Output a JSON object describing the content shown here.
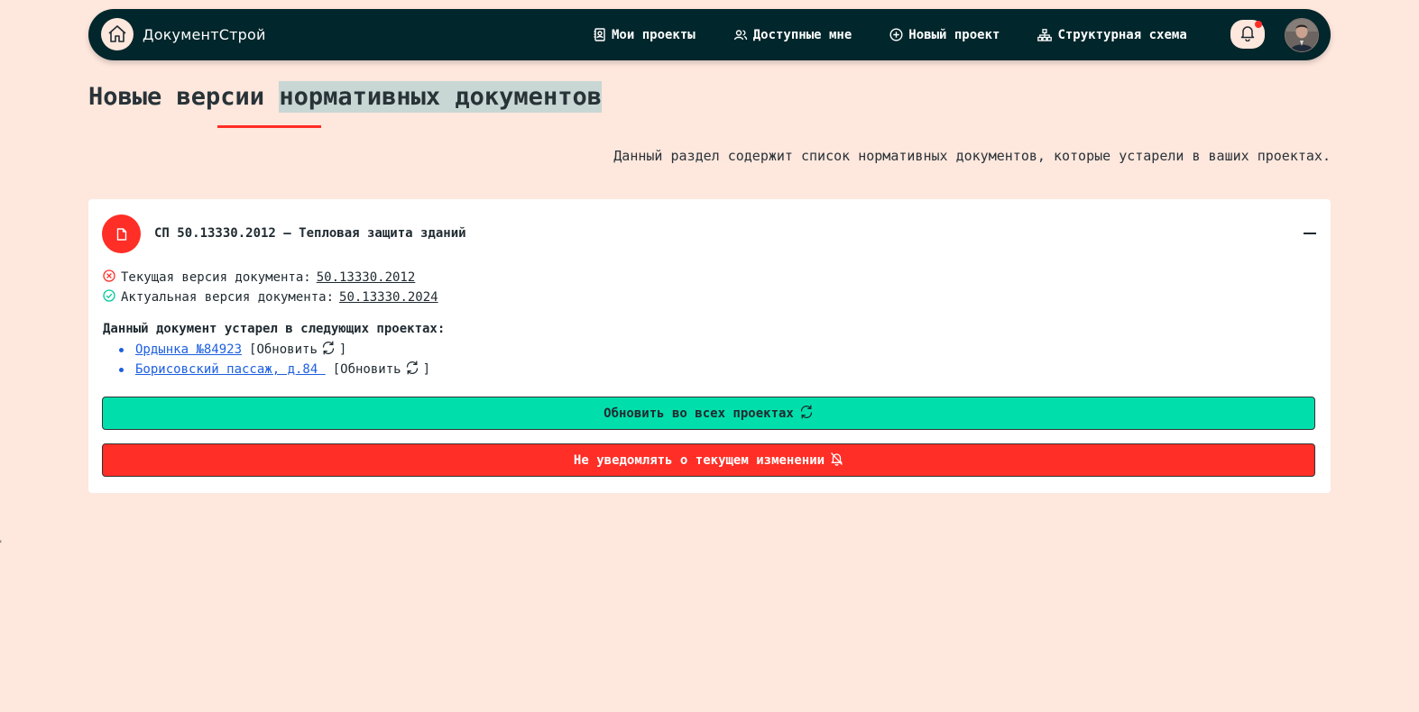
{
  "app": {
    "brand": "ДокументСтрой"
  },
  "nav": {
    "items": [
      {
        "label": "Мои проекты",
        "icon": "contact-book-icon"
      },
      {
        "label": "Доступные мне",
        "icon": "users-icon"
      },
      {
        "label": "Новый проект",
        "icon": "plus-circle-icon"
      },
      {
        "label": "Структурная схема",
        "icon": "hierarchy-icon"
      }
    ],
    "notifications_icon": "bell-icon",
    "has_unread": true
  },
  "page": {
    "title_part1": "Новые версии",
    "title_part2": "нормативных документов",
    "description": "Данный раздел содержит список нормативных документов, которые устарели в ваших проектах."
  },
  "document": {
    "title": "СП 50.13330.2012 — Тепловая защита зданий",
    "current_label": "Текущая версия документа:",
    "current_version": "50.13330.2012",
    "actual_label": "Актуальная версия документа:",
    "actual_version": "50.13330.2024",
    "outdated_heading": "Данный документ устарел в следующих проектах:",
    "projects": [
      {
        "name": "Ордынка №84923",
        "update_label": "[Обновить",
        "close_bracket": "]"
      },
      {
        "name": "Борисовский пассаж, д.84 ",
        "update_label": "[Обновить",
        "close_bracket": "]"
      }
    ],
    "update_all_label": "Обновить во всех проектах",
    "mute_label": "Не уведомлять о текущем изменении"
  },
  "colors": {
    "background": "#fee7dd",
    "navbar": "#01262b",
    "accent_red": "#ff2e26",
    "accent_green": "#00dfab",
    "link_blue": "#1d5fe0",
    "title_highlight": "#c8d7d3"
  }
}
